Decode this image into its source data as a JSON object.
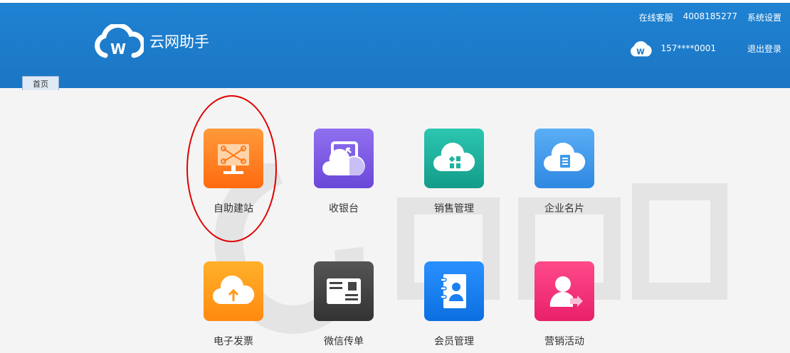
{
  "header": {
    "app_title": "云网助手",
    "links": [
      "在线客服",
      "4008185277",
      "系统设置"
    ],
    "user_phone": "157****0001",
    "logout_label": "退出登录"
  },
  "tabs": [
    {
      "label": "首页"
    }
  ],
  "apps": [
    {
      "label": "自助建站",
      "icon": "monitor-icon",
      "color": "#ff7a1a"
    },
    {
      "label": "收银台",
      "icon": "cashier-icon",
      "color": "#7b5be0"
    },
    {
      "label": "销售管理",
      "icon": "sales-cloud-icon",
      "color": "#1fb3a0"
    },
    {
      "label": "企业名片",
      "icon": "card-cloud-icon",
      "color": "#3d9bea"
    },
    {
      "label": "电子发票",
      "icon": "upload-cloud-icon",
      "color": "#ff9a1a"
    },
    {
      "label": "微信传单",
      "icon": "flyer-icon",
      "color": "#444444"
    },
    {
      "label": "会员管理",
      "icon": "member-book-icon",
      "color": "#1a7ff0"
    },
    {
      "label": "营销活动",
      "icon": "marketing-user-icon",
      "color": "#f0307a"
    }
  ]
}
